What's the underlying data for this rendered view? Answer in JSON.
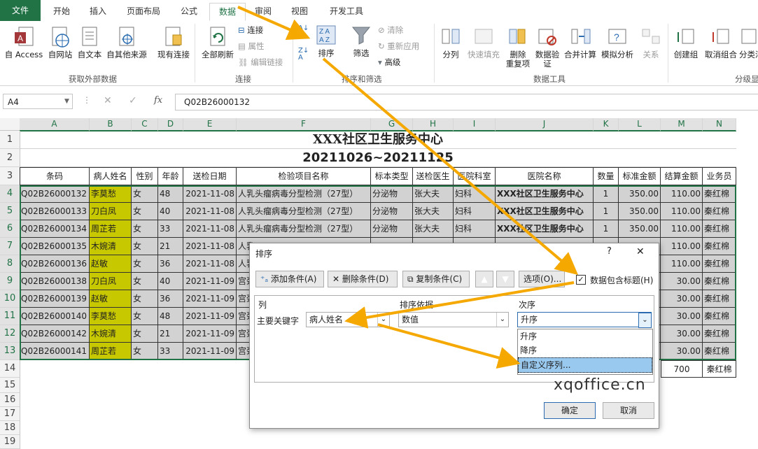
{
  "tabs": [
    "文件",
    "开始",
    "插入",
    "页面布局",
    "公式",
    "数据",
    "审阅",
    "视图",
    "开发工具"
  ],
  "active_tab": "数据",
  "ribbon": {
    "get_external": {
      "access": "自 Access",
      "web": "自网站",
      "text": "自文本",
      "other": "自其他来源",
      "existing": "现有连接",
      "group": "获取外部数据"
    },
    "connections": {
      "refresh": "全部刷新",
      "connect": "连接",
      "props": "属性",
      "edit_links": "编辑链接",
      "group": "连接"
    },
    "sortfilter": {
      "sort": "排序",
      "filter": "筛选",
      "clear": "清除",
      "reapply": "重新应用",
      "advanced": "高级",
      "group": "排序和筛选"
    },
    "datatools": {
      "split": "分列",
      "flash": "快速填充",
      "dedupe": "删除\n重复项",
      "dedupe1": "删除",
      "dedupe2": "重复项",
      "validate1": "数据验",
      "validate2": "证",
      "consolidate": "合并计算",
      "whatif": "模拟分析",
      "relations": "关系",
      "group": "数据工具"
    },
    "outline": {
      "group_btn": "创建组",
      "ungroup": "取消组合",
      "subtotal": "分类汇",
      "group": "分级显"
    }
  },
  "namebox": "A4",
  "formula": "Q02B26000132",
  "columns": [
    "A",
    "B",
    "C",
    "D",
    "E",
    "F",
    "G",
    "H",
    "I",
    "J",
    "K",
    "L",
    "M",
    "N"
  ],
  "rows": [
    "1",
    "2",
    "3",
    "4",
    "5",
    "6",
    "7",
    "8",
    "9",
    "10",
    "11",
    "12",
    "13",
    "14",
    "15",
    "16",
    "17",
    "18",
    "19"
  ],
  "title1": "XXX社区卫生服务中心",
  "title2": "20211026~20211125",
  "headers": [
    "条码",
    "病人姓名",
    "性别",
    "年龄",
    "送检日期",
    "检验项目名称",
    "标本类型",
    "送检医生",
    "医院科室",
    "医院名称",
    "数量",
    "标准金额",
    "结算金额",
    "业务员"
  ],
  "data": [
    [
      "Q02B26000132",
      "李莫愁",
      "女",
      "48",
      "2021-11-08",
      "人乳头瘤病毒分型检测（27型）",
      "分泌物",
      "张大夫",
      "妇科",
      "XXX社区卫生服务中心",
      "1",
      "350.00",
      "110.00",
      "秦红棉"
    ],
    [
      "Q02B26000133",
      "刀白凤",
      "女",
      "40",
      "2021-11-08",
      "人乳头瘤病毒分型检测（27型）",
      "分泌物",
      "张大夫",
      "妇科",
      "XXX社区卫生服务中心",
      "1",
      "350.00",
      "110.00",
      "秦红棉"
    ],
    [
      "Q02B26000134",
      "周芷若",
      "女",
      "33",
      "2021-11-08",
      "人乳头瘤病毒分型检测（27型）",
      "分泌物",
      "张大夫",
      "妇科",
      "XXX社区卫生服务中心",
      "1",
      "350.00",
      "110.00",
      "秦红棉"
    ],
    [
      "Q02B26000135",
      "木婉清",
      "女",
      "21",
      "2021-11-08",
      "人乳",
      "",
      "",
      "",
      "",
      "",
      "",
      "110.00",
      "秦红棉"
    ],
    [
      "Q02B26000136",
      "赵敏",
      "女",
      "36",
      "2021-11-08",
      "人乳",
      "",
      "",
      "",
      "",
      "",
      "",
      "110.00",
      "秦红棉"
    ],
    [
      "Q02B26000138",
      "刀白凤",
      "女",
      "40",
      "2021-11-09",
      "宫颈",
      "",
      "",
      "",
      "",
      "",
      "",
      "30.00",
      "秦红棉"
    ],
    [
      "Q02B26000139",
      "赵敏",
      "女",
      "36",
      "2021-11-09",
      "宫颈",
      "",
      "",
      "",
      "",
      "",
      "",
      "30.00",
      "秦红棉"
    ],
    [
      "Q02B26000140",
      "李莫愁",
      "女",
      "48",
      "2021-11-09",
      "宫颈",
      "",
      "",
      "",
      "",
      "",
      "",
      "30.00",
      "秦红棉"
    ],
    [
      "Q02B26000142",
      "木婉清",
      "女",
      "21",
      "2021-11-09",
      "宫颈",
      "",
      "",
      "",
      "",
      "",
      "",
      "30.00",
      "秦红棉"
    ],
    [
      "Q02B26000141",
      "周芷若",
      "女",
      "33",
      "2021-11-09",
      "宫颈",
      "",
      "",
      "",
      "",
      "",
      "",
      "30.00",
      "秦红棉"
    ]
  ],
  "row14": {
    "total": "700",
    "person": "秦红棉"
  },
  "dialog": {
    "title": "排序",
    "help": "?",
    "close": "✕",
    "add": "添加条件(A)",
    "delete": "删除条件(D)",
    "copy": "复制条件(C)",
    "options": "选项(O)...",
    "header_check": "数据包含标题(H)",
    "col_hdr": "列",
    "basis_hdr": "排序依据",
    "order_hdr": "次序",
    "primary": "主要关键字",
    "key_value": "病人姓名",
    "basis_value": "数值",
    "order_value": "升序",
    "order_options": [
      "升序",
      "降序",
      "自定义序列..."
    ],
    "ok": "确定",
    "cancel": "取消"
  },
  "watermark": "xqoffice.cn",
  "accent": "#217346"
}
